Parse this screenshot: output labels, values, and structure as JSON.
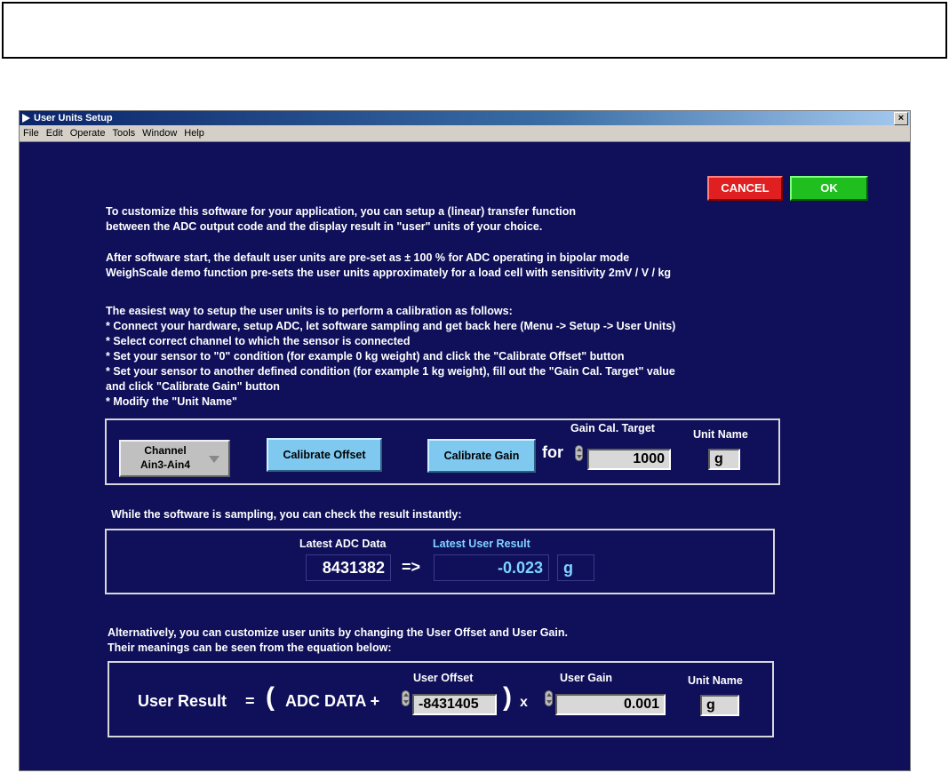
{
  "window": {
    "title": "User Units Setup",
    "close_glyph": "×"
  },
  "menu": [
    "File",
    "Edit",
    "Operate",
    "Tools",
    "Window",
    "Help"
  ],
  "buttons": {
    "cancel": "CANCEL",
    "ok": "OK"
  },
  "intro": [
    "To customize this software for your application, you can setup a (linear) transfer function",
    "between the ADC output code and the display result in \"user\" units of your choice."
  ],
  "defaults": [
    "After software start, the default user units are pre-set as ± 100 % for ADC operating in bipolar mode",
    "WeighScale demo function pre-sets the user units approximately for a load cell with sensitivity 2mV / V / kg"
  ],
  "steps": [
    "The easiest way to setup the user units is to perform a calibration as follows:",
    "* Connect your hardware, setup ADC, let software sampling and get back here (Menu -> Setup -> User Units)",
    "* Select correct channel to which the sensor is connected",
    "* Set your sensor to \"0\" condition (for example 0 kg weight) and click the \"Calibrate Offset\" button",
    "* Set your sensor to another defined condition (for example 1 kg weight), fill out the \"Gain Cal. Target\" value",
    "   and click \"Calibrate Gain\" button",
    "* Modify the \"Unit Name\""
  ],
  "calibration": {
    "channel_label": "Channel",
    "channel_value": "Ain3-Ain4",
    "calibrate_offset": "Calibrate Offset",
    "calibrate_gain": "Calibrate Gain",
    "for_label": "for",
    "gain_target_label": "Gain Cal. Target",
    "gain_target_value": "1000",
    "unit_name_label": "Unit Name",
    "unit_name_value": "g"
  },
  "sampling": {
    "intro": "While the software is sampling, you can check the result instantly:",
    "adc_label": "Latest ADC Data",
    "adc_value": "8431382",
    "arrow": "=>",
    "result_label": "Latest User Result",
    "result_value": "-0.023",
    "unit": "g"
  },
  "equation": {
    "intro": [
      "Alternatively, you can customize user units by changing the User Offset and User Gain.",
      "Their meanings can be seen from the equation below:"
    ],
    "user_result": "User Result",
    "equals": "=",
    "open_paren": "(",
    "adc_data": "ADC DATA +",
    "close_paren_times": ")",
    "times": "x",
    "offset_label": "User Offset",
    "offset_value": "-8431405",
    "gain_label": "User Gain",
    "gain_value": "0.001",
    "unit_label": "Unit Name",
    "unit_value": "g"
  }
}
